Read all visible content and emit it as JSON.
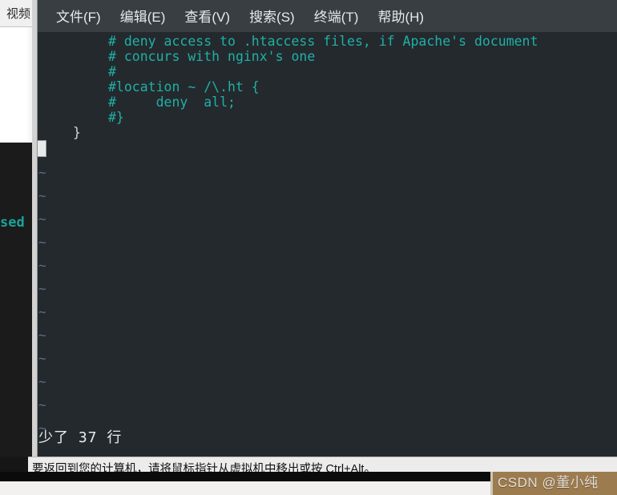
{
  "host": {
    "panel_tab_label": "视频",
    "background_terminal_fragment": "sed"
  },
  "terminal": {
    "menu": [
      {
        "label": "文件(F)",
        "name": "file"
      },
      {
        "label": "编辑(E)",
        "name": "edit"
      },
      {
        "label": "查看(V)",
        "name": "view"
      },
      {
        "label": "搜索(S)",
        "name": "search"
      },
      {
        "label": "终端(T)",
        "name": "terminal"
      },
      {
        "label": "帮助(H)",
        "name": "help"
      }
    ],
    "editor": {
      "lines": [
        {
          "text": "# deny access to .htaccess files, if Apache's document",
          "kind": "comment"
        },
        {
          "text": "# concurs with nginx's one",
          "kind": "comment"
        },
        {
          "text": "#",
          "kind": "comment"
        },
        {
          "text": "#location ~ /\\.ht {",
          "kind": "comment"
        },
        {
          "text": "#     deny  all;",
          "kind": "comment"
        },
        {
          "text": "#}",
          "kind": "comment"
        },
        {
          "text": "}",
          "kind": "plain"
        }
      ],
      "tilde_char": "~",
      "tilde_count": 12,
      "status_message": "少了 37 行",
      "colors": {
        "background": "#24292d",
        "comment": "#1fb0a6",
        "plain_text": "#d4d7d9",
        "tilde": "#5b6f8c",
        "cursor": "#e8eaea",
        "menubar": "#383e42"
      }
    }
  },
  "vmware": {
    "status_message": "要返回到您的计算机，请将鼠标指针从虚拟机中移出或按 Ctrl+Alt。"
  },
  "watermark": {
    "text": "CSDN @董小纯"
  }
}
